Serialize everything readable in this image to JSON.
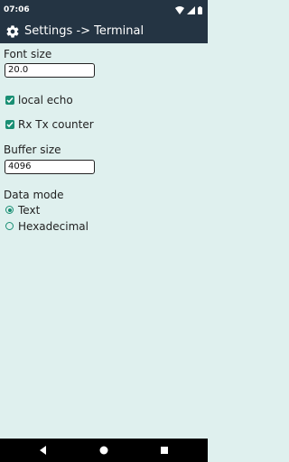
{
  "status_bar": {
    "time": "07:06"
  },
  "app_bar": {
    "title": "Settings -> Terminal"
  },
  "font_size": {
    "label": "Font size",
    "value": "20.0"
  },
  "local_echo": {
    "label": "local echo",
    "checked": true
  },
  "rx_tx_counter": {
    "label": "Rx Tx counter",
    "checked": true
  },
  "buffer_size": {
    "label": "Buffer size",
    "value": "4096"
  },
  "data_mode": {
    "label": "Data mode",
    "options": [
      {
        "label": "Text",
        "selected": true
      },
      {
        "label": "Hexadecimal",
        "selected": false
      }
    ]
  },
  "colors": {
    "accent": "#1a8f74",
    "bar": "#243443",
    "background": "#dff0ee"
  }
}
